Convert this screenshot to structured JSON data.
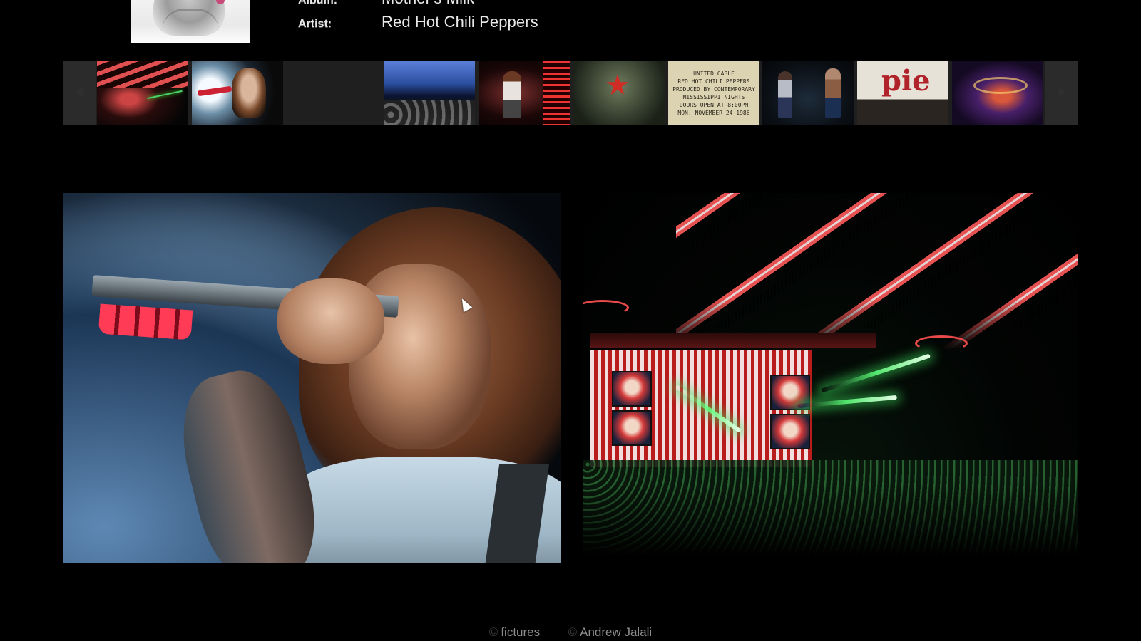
{
  "header": {
    "album_label": "Album:",
    "album_value": "Mother's Milk",
    "artist_label": "Artist:",
    "artist_value": "Red Hot Chili Peppers"
  },
  "thumbnails": {
    "prev_icon": "chevron-left-icon",
    "next_icon": "chevron-right-icon",
    "poster_lines": [
      "UNITED CABLE",
      "RED HOT CHILI PEPPERS",
      "PRODUCED BY CONTEMPORARY",
      "MISSISSIPPI NIGHTS",
      "DOORS OPEN AT 8:00PM",
      "MON. NOVEMBER 24 1986"
    ],
    "sign_text": "pie"
  },
  "footer": {
    "copyright_symbol": "©",
    "link_1": "fictures",
    "link_2": "Andrew Jalali"
  },
  "colors": {
    "background": "#000000",
    "strip": "#1f1f1f",
    "text": "#e8e8e8",
    "footer_link": "#8d8d8d"
  }
}
